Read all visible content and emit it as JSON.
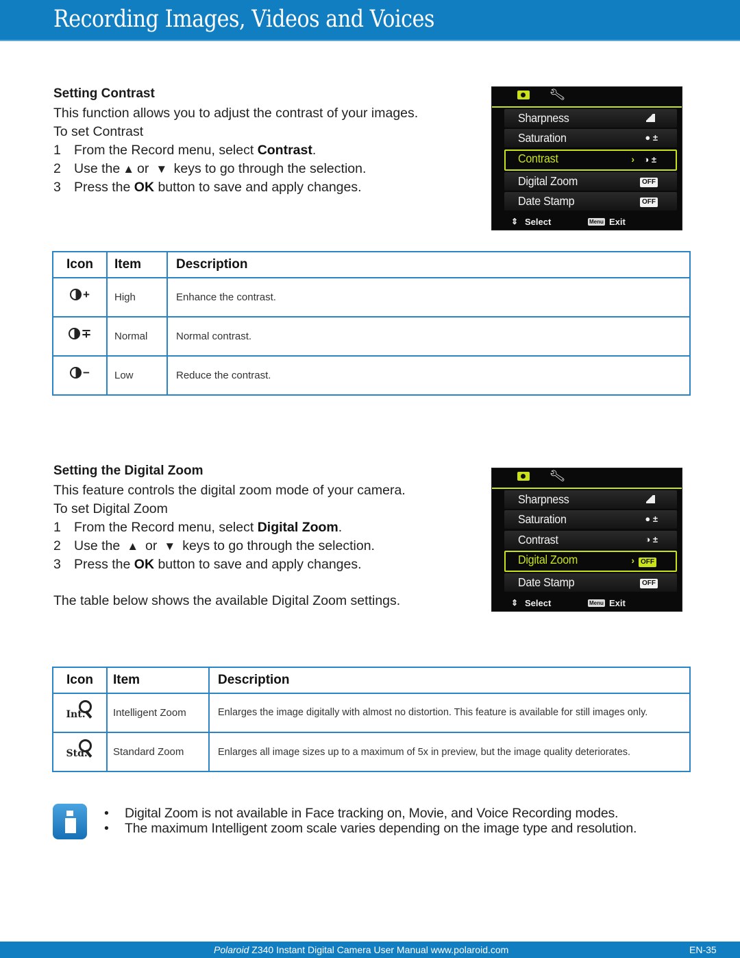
{
  "header": {
    "title": "Recording Images, Videos and Voices"
  },
  "contrast_section": {
    "heading": "Setting Contrast",
    "intro": "This function allows you to adjust the contrast of your images.",
    "to_set": "To set Contrast",
    "steps": [
      {
        "num": "1",
        "pre": "From the Record menu, select ",
        "bold": "Contrast",
        "post": "."
      },
      {
        "num": "2",
        "pre": "Use the",
        "up": "▲",
        "or": "or",
        "down": "▼",
        "post": "keys to go through the selection."
      },
      {
        "num": "3",
        "pre": "Press the ",
        "bold": "OK",
        "post": " button to save and apply changes."
      }
    ]
  },
  "camera_screen_1": {
    "tab_icons": [
      "camera-icon",
      "wrench-icon"
    ],
    "rows": [
      {
        "label": "Sharpness",
        "value_icon": "sharpness-icon"
      },
      {
        "label": "Saturation",
        "value_icon": "saturation-icon",
        "value_text": "±"
      },
      {
        "label": "Contrast",
        "value_icon": "contrast-icon",
        "value_text": "±",
        "selected": true
      },
      {
        "label": "Digital Zoom",
        "value_text": "OFF"
      },
      {
        "label": "Date Stamp",
        "value_text": "OFF"
      }
    ],
    "footer": {
      "select_label": "Select",
      "menu_badge": "Menu",
      "exit_label": "Exit"
    },
    "accent_color": "#c9e21a"
  },
  "contrast_table": {
    "headers": [
      "Icon",
      "Item",
      "Description"
    ],
    "rows": [
      {
        "icon": "contrast-high-icon",
        "icon_sign": "+",
        "item": "High",
        "description": "Enhance the contrast."
      },
      {
        "icon": "contrast-normal-icon",
        "icon_sign": "∓",
        "item": "Normal",
        "description": "Normal contrast."
      },
      {
        "icon": "contrast-low-icon",
        "icon_sign": "−",
        "item": "Low",
        "description": "Reduce the contrast."
      }
    ]
  },
  "zoom_section": {
    "heading": "Setting the Digital Zoom",
    "intro": "This feature controls the digital zoom mode of your camera.",
    "to_set": "To set Digital Zoom",
    "steps": [
      {
        "num": "1",
        "pre": "From the Record menu, select ",
        "bold": "Digital Zoom",
        "post": "."
      },
      {
        "num": "2",
        "pre": "Use the",
        "up": "▲",
        "or": "or",
        "down": "▼",
        "post": "keys to go through the selection."
      },
      {
        "num": "3",
        "pre": "Press the ",
        "bold": "OK",
        "post": " button to save and apply changes."
      }
    ],
    "table_note": "The table below shows the available Digital Zoom settings."
  },
  "camera_screen_2": {
    "rows": [
      {
        "label": "Sharpness"
      },
      {
        "label": "Saturation",
        "value_text": "±"
      },
      {
        "label": "Contrast",
        "value_text": "±"
      },
      {
        "label": "Digital Zoom",
        "value_text": "OFF",
        "selected": true
      },
      {
        "label": "Date Stamp",
        "value_text": "OFF"
      }
    ],
    "footer": {
      "select_label": "Select",
      "menu_badge": "Menu",
      "exit_label": "Exit"
    }
  },
  "zoom_table": {
    "headers": [
      "Icon",
      "Item",
      "Description"
    ],
    "rows": [
      {
        "icon": "intelligent-zoom-icon",
        "icon_text": "Int.",
        "item": "Intelligent Zoom",
        "description": "Enlarges the image digitally with almost no distortion. This feature is available for still images only."
      },
      {
        "icon": "standard-zoom-icon",
        "icon_text": "Std.",
        "item": "Standard Zoom",
        "description": "Enlarges all image sizes up to a maximum of 5x in preview, but the image quality deteriorates."
      }
    ]
  },
  "notes": {
    "icon": "info-icon",
    "bullet": "•",
    "items": [
      "Digital Zoom is not available in Face tracking on, Movie, and Voice Recording modes.",
      "The maximum Intelligent zoom scale varies depending on the image type and resolution."
    ]
  },
  "footer": {
    "brand": "Polaroid",
    "text": " Z340 Instant Digital Camera User Manual www.polaroid.com",
    "page": "EN-35"
  },
  "colors": {
    "brand_blue": "#127ec2",
    "table_border": "#2a84c6",
    "camera_accent": "#c9e21a"
  }
}
